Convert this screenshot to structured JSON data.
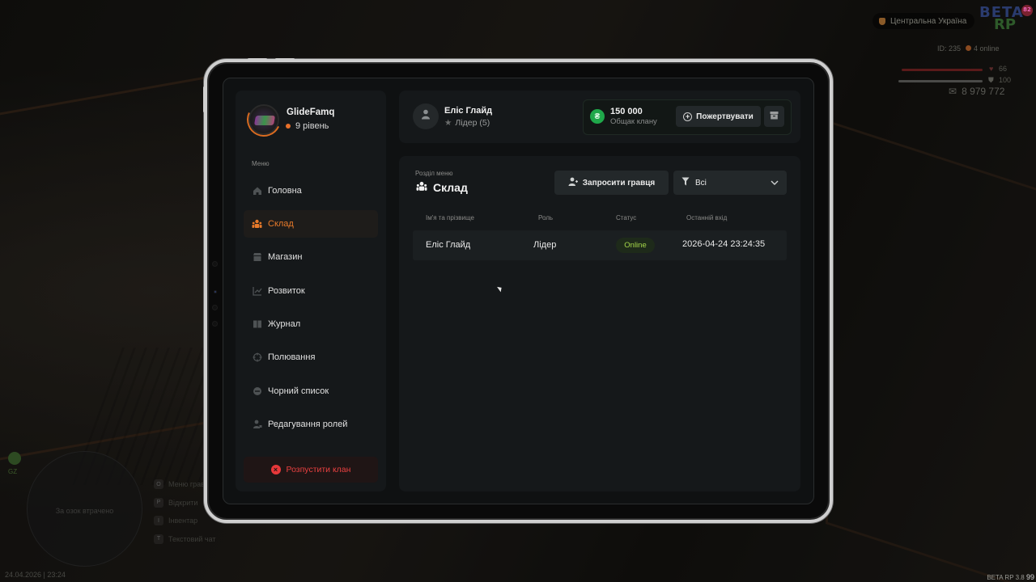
{
  "hud": {
    "region": "Центральна Україна",
    "logo_line1": "BETA",
    "logo_line2": "RP",
    "logo_badge": "82",
    "player_id": "ID: 235",
    "online": "4 online",
    "health": "66",
    "armor": "100",
    "money": "8 979 772",
    "minimap_label": "За озок втрачено",
    "zone": "GZ",
    "datetime": "24.04.2026 | 23:24",
    "keys": [
      {
        "key": "O",
        "label": "Меню гравця"
      },
      {
        "key": "P",
        "label": "Відкрити"
      },
      {
        "key": "I",
        "label": "Інвентар"
      },
      {
        "key": "T",
        "label": "Текстовий чат"
      }
    ],
    "version": "BETA RP 3.8",
    "version_extra": "99",
    "colors": {
      "health": "#5a1a1a",
      "accent": "#e87a2a",
      "online": "#a6d84a",
      "coin": "#1fa84a",
      "danger": "#e8383a"
    }
  },
  "clan": {
    "name": "GlideFamq",
    "level": "9 рівень"
  },
  "sidebar": {
    "caption": "Меню",
    "items": [
      {
        "label": "Головна",
        "icon": "home-icon",
        "active": false
      },
      {
        "label": "Склад",
        "icon": "people-icon",
        "active": true
      },
      {
        "label": "Магазин",
        "icon": "shop-icon",
        "active": false
      },
      {
        "label": "Розвиток",
        "icon": "chart-icon",
        "active": false
      },
      {
        "label": "Журнал",
        "icon": "book-icon",
        "active": false
      },
      {
        "label": "Полювання",
        "icon": "crosshair-icon",
        "active": false
      },
      {
        "label": "Чорний список",
        "icon": "block-icon",
        "active": false
      },
      {
        "label": "Редагування ролей",
        "icon": "user-edit-icon",
        "active": false
      }
    ],
    "dissolve_label": "Розпустити клан"
  },
  "user": {
    "name": "Еліс Глайд",
    "role": "Лідер (5)"
  },
  "bank": {
    "amount": "150 000",
    "label": "Общак клану",
    "donate_label": "Пожертвувати"
  },
  "section": {
    "caption": "Розділ меню",
    "title": "Склад",
    "invite_label": "Запросити гравця",
    "filter_value": "Всі"
  },
  "table": {
    "headers": [
      "Ім'я та прізвище",
      "Роль",
      "Статус",
      "Останній вхід"
    ],
    "rows": [
      {
        "name": "Еліс Глайд",
        "role": "Лідер",
        "status": "Online",
        "last_login": "2026-04-24 23:24:35"
      }
    ]
  }
}
